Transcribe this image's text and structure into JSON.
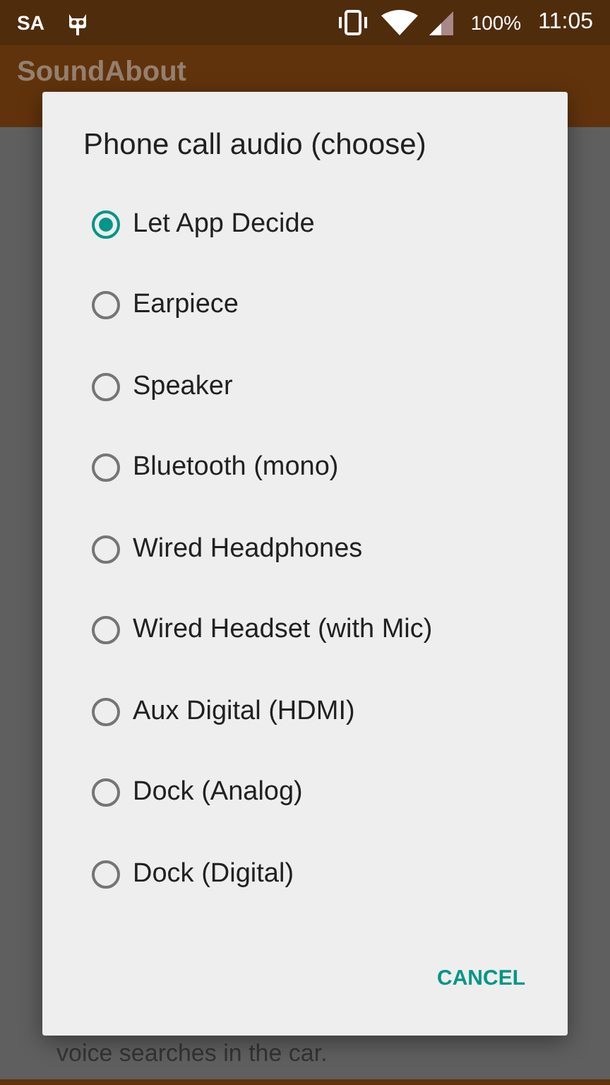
{
  "status_bar": {
    "carrier": "SA",
    "battery": "100%",
    "time": "11:05"
  },
  "app_bar": {
    "title": "SoundAbout"
  },
  "background": {
    "lines": [
      "voice searches in the car."
    ]
  },
  "dialog": {
    "title": "Phone call audio (choose)",
    "options": [
      {
        "label": "Let App Decide",
        "selected": true
      },
      {
        "label": "Earpiece",
        "selected": false
      },
      {
        "label": "Speaker",
        "selected": false
      },
      {
        "label": "Bluetooth (mono)",
        "selected": false
      },
      {
        "label": "Wired Headphones",
        "selected": false
      },
      {
        "label": "Wired Headset (with Mic)",
        "selected": false
      },
      {
        "label": "Aux Digital (HDMI)",
        "selected": false
      },
      {
        "label": "Dock (Analog)",
        "selected": false
      },
      {
        "label": "Dock (Digital)",
        "selected": false
      }
    ],
    "buttons": [
      "CANCEL"
    ]
  }
}
